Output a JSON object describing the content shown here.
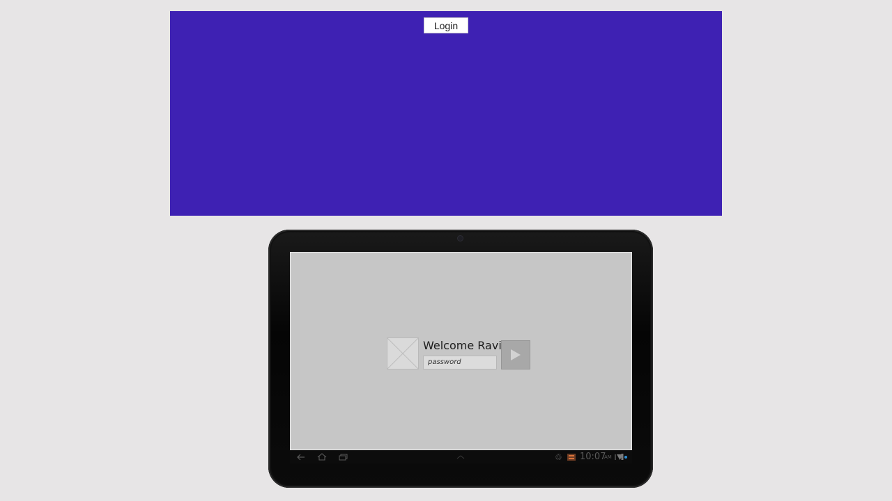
{
  "banner": {
    "color": "#3e21b3",
    "login_label": "Login"
  },
  "tablet": {
    "screen": {
      "welcome_text": "Welcome Ravi!",
      "password_placeholder": "password",
      "image_icon": "image-placeholder-icon",
      "go_icon": "play-icon"
    },
    "system_bar": {
      "icons": [
        "back-icon",
        "home-icon",
        "recent-apps-icon",
        "up-chevron-icon",
        "recycle-icon",
        "notification-icon",
        "wifi-icon",
        "signal-icon",
        "battery-icon"
      ],
      "time": "10:07",
      "ampm": "AM",
      "accent": "#2e8fd6"
    }
  }
}
